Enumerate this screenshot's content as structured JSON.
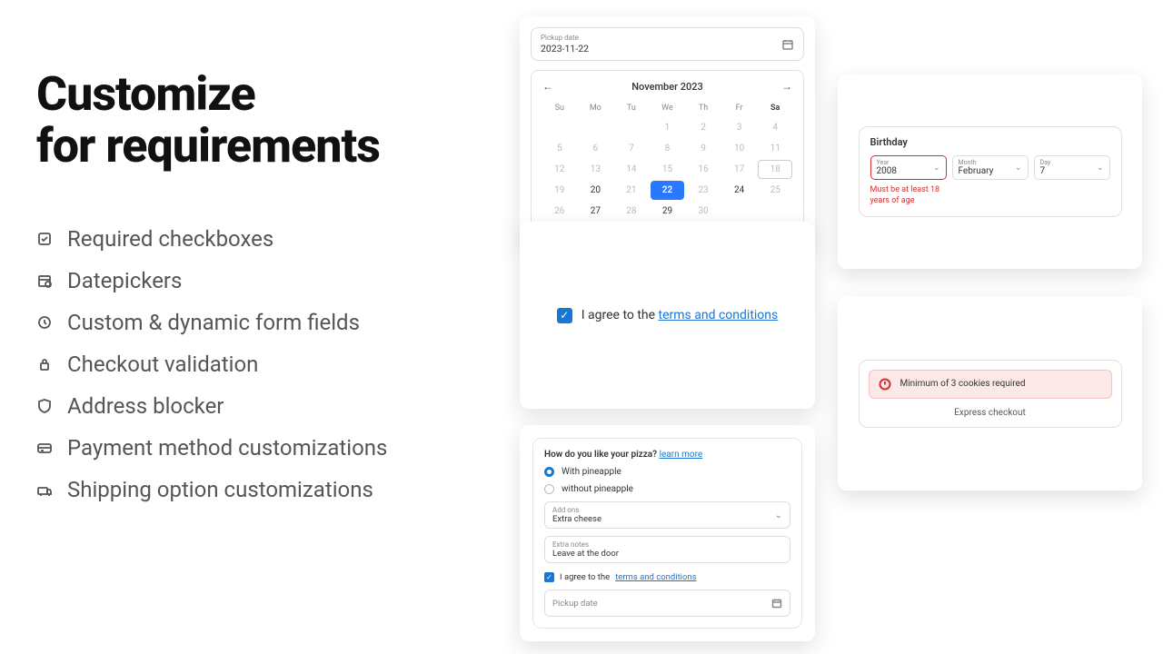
{
  "headline_l1": "Customize",
  "headline_l2": "for requirements",
  "features": [
    "Required checkboxes",
    "Datepickers",
    "Custom & dynamic form fields",
    "Checkout validation",
    "Address blocker",
    "Payment method customizations",
    "Shipping option customizations"
  ],
  "calendar": {
    "field_label": "Pickup date",
    "field_value": "2023-11-22",
    "month": "November 2023",
    "dow": [
      "Su",
      "Mo",
      "Tu",
      "We",
      "Th",
      "Fr",
      "Sa"
    ],
    "days": [
      {
        "n": "",
        "s": ""
      },
      {
        "n": "",
        "s": ""
      },
      {
        "n": "",
        "s": ""
      },
      {
        "n": "1",
        "s": "d"
      },
      {
        "n": "2",
        "s": "d"
      },
      {
        "n": "3",
        "s": "d"
      },
      {
        "n": "4",
        "s": "d"
      },
      {
        "n": "5",
        "s": "d"
      },
      {
        "n": "6",
        "s": "d"
      },
      {
        "n": "7",
        "s": "d"
      },
      {
        "n": "8",
        "s": "d"
      },
      {
        "n": "9",
        "s": "d"
      },
      {
        "n": "10",
        "s": "d"
      },
      {
        "n": "11",
        "s": "d"
      },
      {
        "n": "12",
        "s": "d"
      },
      {
        "n": "13",
        "s": "d"
      },
      {
        "n": "14",
        "s": "d"
      },
      {
        "n": "15",
        "s": "d"
      },
      {
        "n": "16",
        "s": "d"
      },
      {
        "n": "17",
        "s": "d"
      },
      {
        "n": "18",
        "s": "hov"
      },
      {
        "n": "19",
        "s": "d"
      },
      {
        "n": "20",
        "s": "en"
      },
      {
        "n": "21",
        "s": "d"
      },
      {
        "n": "22",
        "s": "sel"
      },
      {
        "n": "23",
        "s": "d"
      },
      {
        "n": "24",
        "s": "en"
      },
      {
        "n": "25",
        "s": "d"
      },
      {
        "n": "26",
        "s": "d"
      },
      {
        "n": "27",
        "s": "en"
      },
      {
        "n": "28",
        "s": "d"
      },
      {
        "n": "29",
        "s": "en"
      },
      {
        "n": "30",
        "s": "d"
      },
      {
        "n": "",
        "s": ""
      },
      {
        "n": "",
        "s": ""
      }
    ]
  },
  "terms": {
    "text": "I agree to the ",
    "link": "terms and conditions"
  },
  "pizza": {
    "question": "How do you like your pizza? ",
    "learn": "learn more",
    "opt1": "With pineapple",
    "opt2": "without pineapple",
    "addons_label": "Add ons",
    "addons_value": "Extra cheese",
    "notes_label": "Extra notes",
    "notes_value": "Leave at the door",
    "agree_text": "I agree to the ",
    "agree_link": "terms and conditions",
    "pickup_placeholder": "Pickup date"
  },
  "birthday": {
    "title": "Birthday",
    "year_label": "Year",
    "year_value": "2008",
    "month_label": "Month",
    "month_value": "February",
    "day_label": "Day",
    "day_value": "7",
    "error": "Must be at least 18 years of age"
  },
  "validation": {
    "message": "Minimum of 3 cookies required",
    "express": "Express checkout"
  }
}
